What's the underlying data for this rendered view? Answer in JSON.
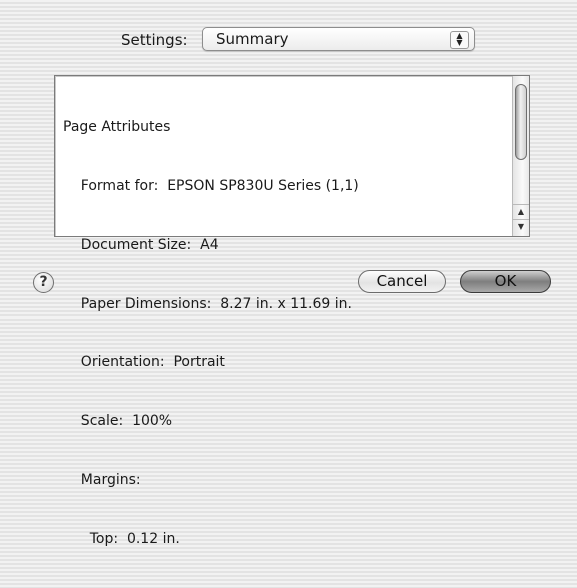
{
  "settings": {
    "label": "Settings:",
    "selected": "Summary",
    "popup_arrows_icon": "updown-arrows"
  },
  "summary": {
    "lines": [
      "Page Attributes",
      "    Format for:  EPSON SP830U Series (1,1)",
      "    Document Size:  A4",
      "    Paper Dimensions:  8.27 in. x 11.69 in.",
      "    Orientation:  Portrait",
      "    Scale:  100%",
      "    Margins:",
      "      Top:  0.12 in."
    ]
  },
  "scrollbar": {
    "up_icon": "scroll-up-arrow",
    "down_icon": "scroll-down-arrow"
  },
  "buttons": {
    "help": "?",
    "cancel": "Cancel",
    "ok": "OK"
  }
}
